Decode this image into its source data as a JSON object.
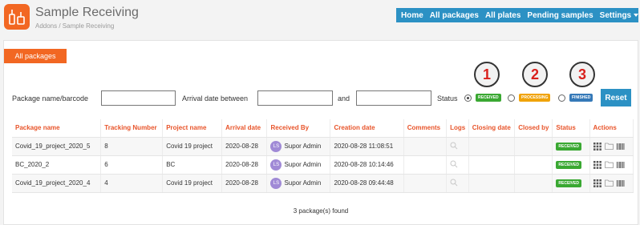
{
  "app": {
    "title": "Sample Receiving",
    "breadcrumb": "Addons / Sample Receiving"
  },
  "nav": {
    "items": [
      "Home",
      "All packages",
      "All plates",
      "Pending samples",
      "Settings"
    ]
  },
  "tab": {
    "label": "All packages"
  },
  "markers": [
    "1",
    "2",
    "3"
  ],
  "filters": {
    "package_label": "Package name/barcode",
    "package_value": "",
    "arrival_label": "Arrival date between",
    "arrival_from": "",
    "and_label": "and",
    "arrival_to": "",
    "status_label": "Status",
    "status_options": [
      {
        "label": "RECEIVED",
        "color": "#3aa832",
        "checked": true
      },
      {
        "label": "PROCESSING",
        "color": "#f0a30a",
        "checked": false
      },
      {
        "label": "FINISHED",
        "color": "#3579b8",
        "checked": false
      }
    ],
    "reset_label": "Reset"
  },
  "table": {
    "columns": [
      "Package name",
      "Tracking Number",
      "Project name",
      "Arrival date",
      "Received By",
      "Creation date",
      "Comments",
      "Logs",
      "Closing date",
      "Closed by",
      "Status",
      "Actions"
    ],
    "rows": [
      {
        "package_name": "Covid_19_project_2020_5",
        "tracking": "8",
        "project": "Covid 19 project",
        "arrival": "2020-08-28",
        "initials": "LS",
        "received_by": "Supor Admin",
        "created": "2020-08-28 11:08:51",
        "comments": "",
        "closing": "",
        "closed_by": "",
        "status": "RECEIVED"
      },
      {
        "package_name": "BC_2020_2",
        "tracking": "6",
        "project": "BC",
        "arrival": "2020-08-28",
        "initials": "LS",
        "received_by": "Supor Admin",
        "created": "2020-08-28 10:14:46",
        "comments": "",
        "closing": "",
        "closed_by": "",
        "status": "RECEIVED"
      },
      {
        "package_name": "Covid_19_project_2020_4",
        "tracking": "4",
        "project": "Covid 19 project",
        "arrival": "2020-08-28",
        "initials": "LS",
        "received_by": "Supor Admin",
        "created": "2020-08-28 09:44:48",
        "comments": "",
        "closing": "",
        "closed_by": "",
        "status": "RECEIVED"
      }
    ],
    "footer": "3 package(s) found"
  },
  "colors": {
    "brand_orange": "#f26722",
    "nav_blue": "#2c91c4",
    "header_text": "#e8542a",
    "received_green": "#3aa832"
  },
  "icons": [
    "logo-icon",
    "search-icon",
    "grid-icon",
    "folder-icon",
    "barcode-icon",
    "caret-down-icon"
  ]
}
